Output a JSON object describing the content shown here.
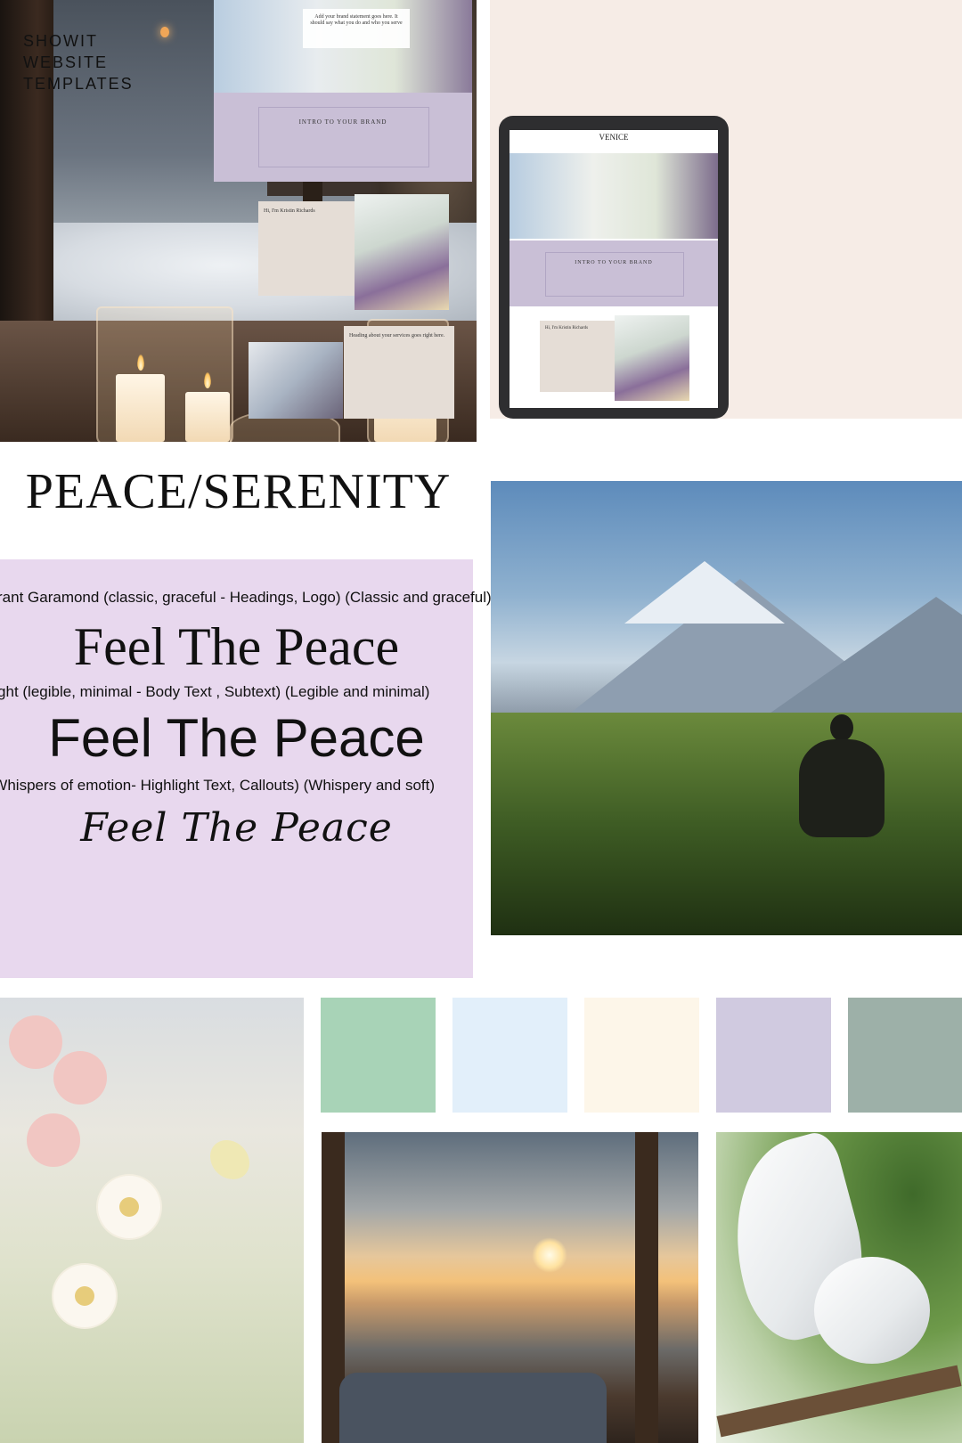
{
  "showit": {
    "title": "SHOWIT\nWEBSITE\nTEMPLATES",
    "hero_text": "Add your brand statement goes here. It should say what you do and who you serve",
    "intro_title": "INTRO TO YOUR BRAND",
    "about_title": "Hi, I'm Kristin Richards",
    "services_title": "Heading about your services goes right here.",
    "tablet_brand": "VENICE"
  },
  "moodboard": {
    "headline": "PEACE/SERENITY",
    "fonts": [
      {
        "note": "Cormorant Garamond (classic, graceful - Headings, Logo) (Classic and graceful)",
        "sample": "Feel The Peace",
        "style": "serif"
      },
      {
        "note": "Lato Light (legible, minimal - Body Text , Subtext) (Legible and minimal)",
        "sample": "Feel The Peace",
        "style": "sans"
      },
      {
        "note": "Aura (Whispers of emotion- Highlight Text, Callouts) (Whispery and soft)",
        "sample": "Feel The Peace",
        "style": "script"
      }
    ],
    "palette": [
      "#a8d3b7",
      "#e2effa",
      "#fdf6e9",
      "#d0cae0",
      "#9db0a8"
    ]
  },
  "colors": {
    "font_card_bg": "#e8d8ee",
    "showit_band": "#c9bfd6"
  }
}
